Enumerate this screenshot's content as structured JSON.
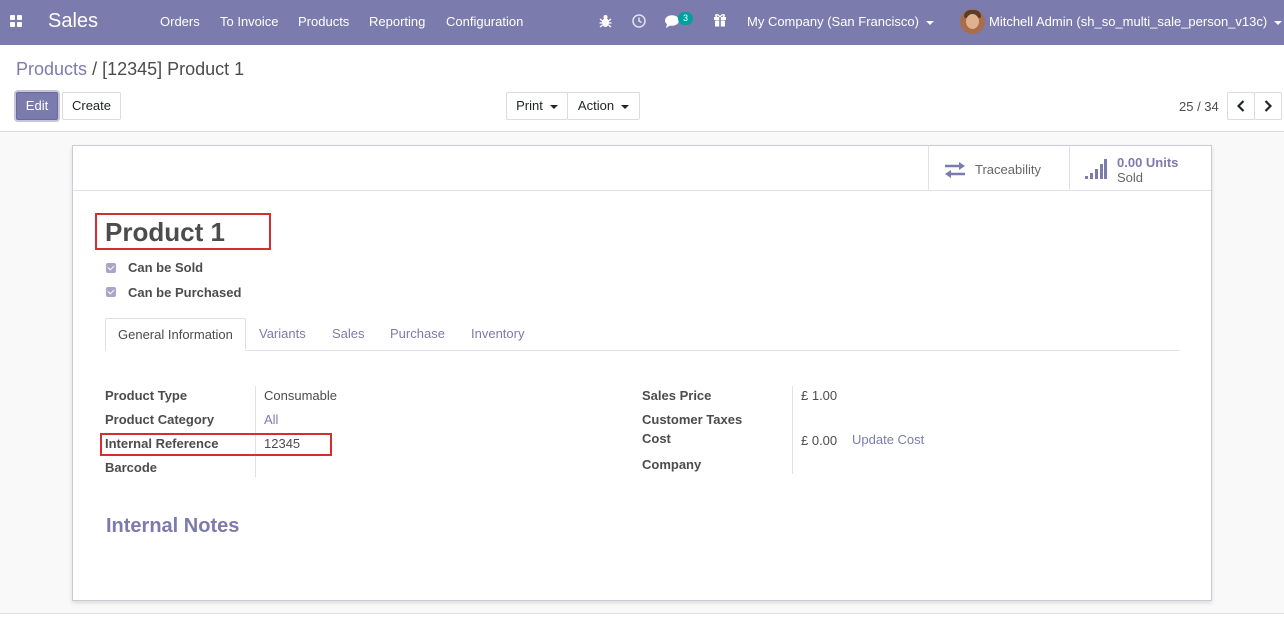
{
  "navbar": {
    "app_name": "Sales",
    "menu": [
      "Orders",
      "To Invoice",
      "Products",
      "Reporting",
      "Configuration"
    ],
    "chat_badge": "3",
    "company": "My Company (San Francisco)",
    "user": "Mitchell Admin (sh_so_multi_sale_person_v13c)",
    "icons": [
      "apps-grid-icon",
      "bug-icon",
      "clock-icon",
      "chat-icon",
      "gift-icon"
    ]
  },
  "breadcrumb": {
    "parent": "Products",
    "separator": "/",
    "current": "[12345] Product 1"
  },
  "controls": {
    "edit": "Edit",
    "create": "Create",
    "print": "Print",
    "action": "Action",
    "pager": "25 / 34"
  },
  "stats": {
    "traceability": "Traceability",
    "sold_value": "0.00 Units",
    "sold_label": "Sold"
  },
  "product": {
    "name": "Product 1",
    "can_be_sold": "Can be Sold",
    "can_be_purchased": "Can be Purchased"
  },
  "tabs": [
    "General Information",
    "Variants",
    "Sales",
    "Purchase",
    "Inventory"
  ],
  "left_fields": {
    "type_label": "Product Type",
    "type_value": "Consumable",
    "category_label": "Product Category",
    "category_value": "All",
    "ref_label": "Internal Reference",
    "ref_value": "12345",
    "barcode_label": "Barcode",
    "barcode_value": ""
  },
  "right_fields": {
    "price_label": "Sales Price",
    "price_value": "£ 1.00",
    "taxes_label": "Customer Taxes",
    "taxes_value": "",
    "cost_label": "Cost",
    "cost_value": "£ 0.00",
    "update_cost": "Update Cost",
    "company_label": "Company",
    "company_value": ""
  },
  "notes_title": "Internal Notes",
  "colors": {
    "brand": "#7c7bad",
    "highlight": "#d32f2f",
    "badge": "#00a09d"
  }
}
